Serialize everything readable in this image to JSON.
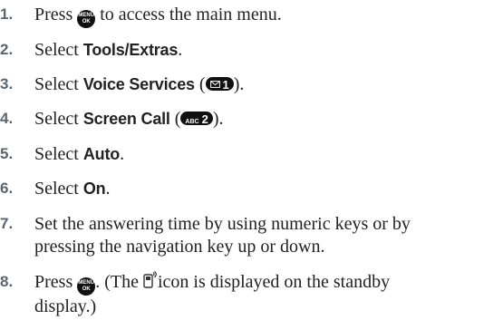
{
  "steps": [
    {
      "number": "1.",
      "before": "Press",
      "key": {
        "icon": "menu-ok-key-icon",
        "line1": "MENU",
        "line2": "OK"
      },
      "after": "to access the main menu."
    },
    {
      "number": "2.",
      "before": "Select",
      "term": "Tools/Extras",
      "after": "."
    },
    {
      "number": "3.",
      "before": "Select",
      "term": "Voice Services",
      "open": " (",
      "key": {
        "icon": "envelope-key-icon",
        "digit": "1"
      },
      "close": ")."
    },
    {
      "number": "4.",
      "before": "Select",
      "term": "Screen Call",
      "open": " (",
      "key": {
        "icon": "abc-key-icon",
        "letters": "ABC",
        "digit": "2"
      },
      "close": ")."
    },
    {
      "number": "5.",
      "before": "Select",
      "term": "Auto",
      "after": "."
    },
    {
      "number": "6.",
      "before": "Select",
      "term": "On",
      "after": "."
    },
    {
      "number": "7.",
      "line1": "Set the answering time by using numeric keys or by",
      "line2": "pressing the navigation key up or down."
    },
    {
      "number": "8.",
      "before": "Press",
      "key": {
        "icon": "menu-ok-key-icon",
        "line1": "MENU",
        "line2": "OK"
      },
      "mid": ". (The",
      "status_icon": "screen-call-phone-icon",
      "tail1": "icon is displayed on the standby",
      "line2": "display.)"
    }
  ]
}
